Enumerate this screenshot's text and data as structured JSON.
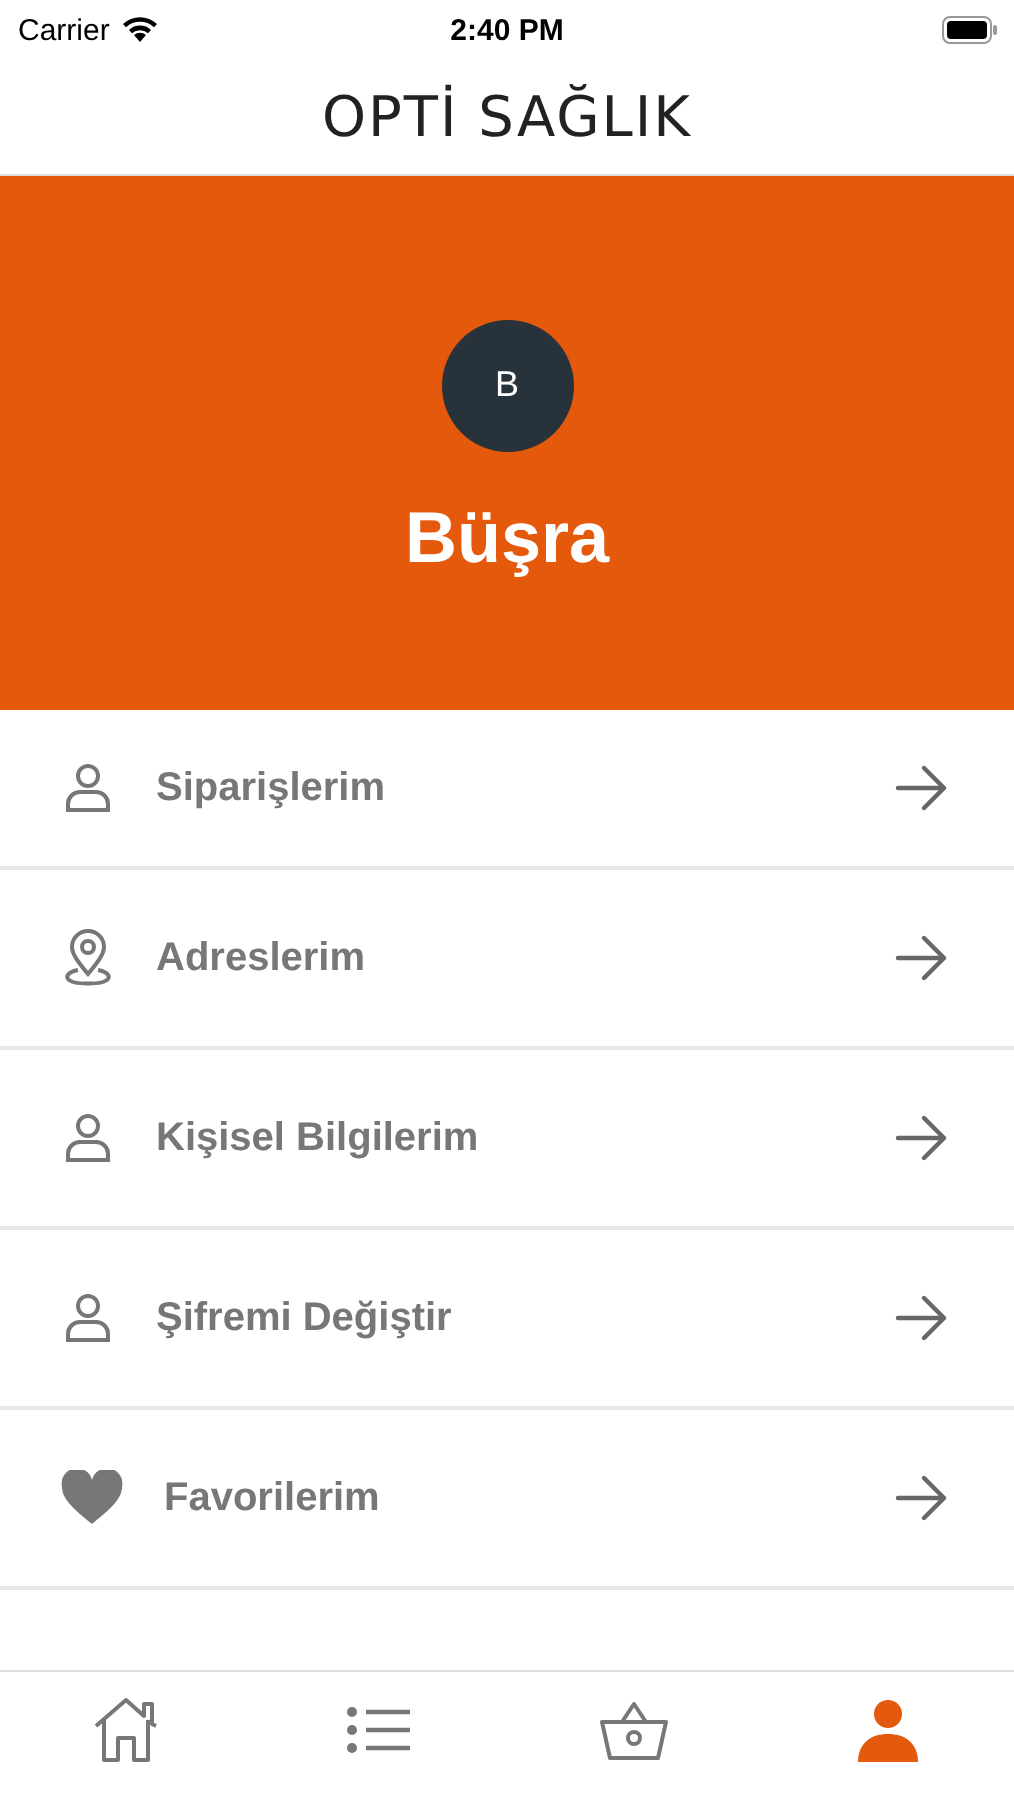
{
  "status_bar": {
    "carrier": "Carrier",
    "time": "2:40 PM"
  },
  "header": {
    "logo": "OPTİ SAĞLIK"
  },
  "profile": {
    "initial": "B",
    "name": "Büşra"
  },
  "menu": [
    {
      "kind": "person",
      "label": "Siparişlerim"
    },
    {
      "kind": "pin",
      "label": "Adreslerim"
    },
    {
      "kind": "person",
      "label": "Kişisel Bilgilerim"
    },
    {
      "kind": "person",
      "label": "Şifremi Değiştir"
    },
    {
      "kind": "heart",
      "label": "Favorilerim"
    }
  ],
  "tabs": [
    {
      "kind": "home",
      "selected": false
    },
    {
      "kind": "list",
      "selected": false
    },
    {
      "kind": "basket",
      "selected": false
    },
    {
      "kind": "user",
      "selected": true
    }
  ]
}
